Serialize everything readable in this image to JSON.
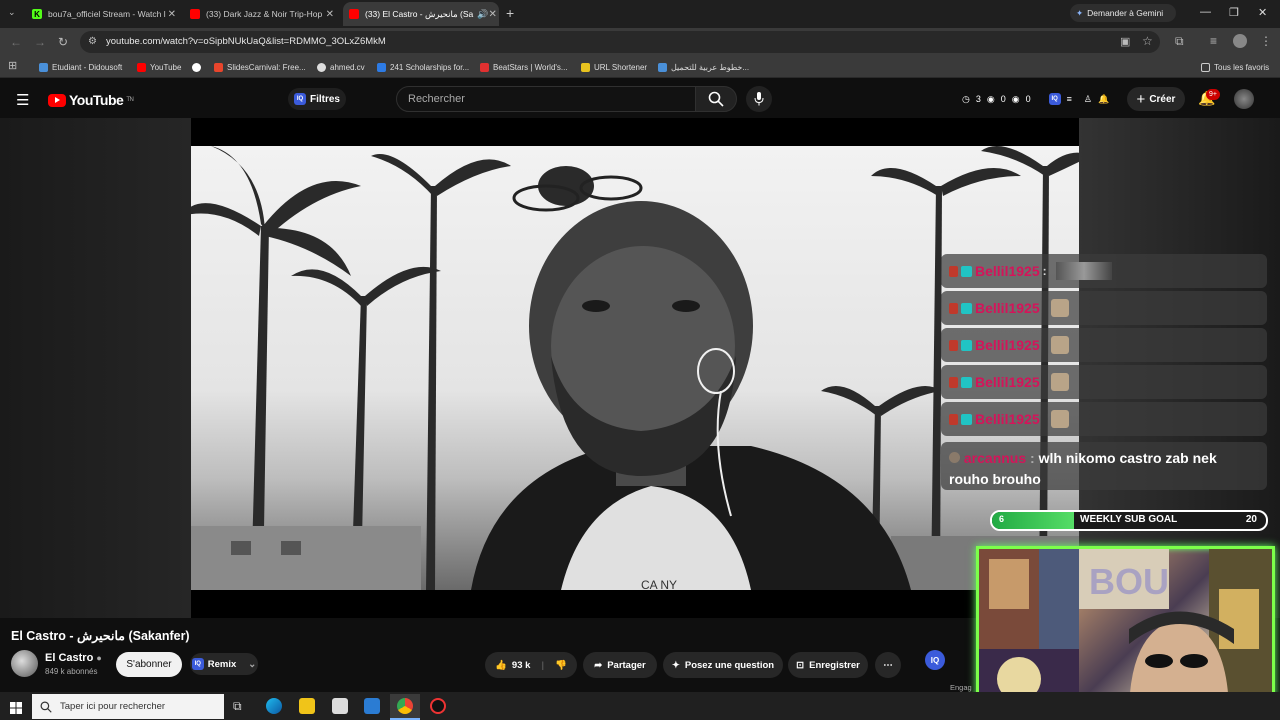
{
  "browser": {
    "tabs": [
      {
        "label": "bou7a_officiel Stream - Watch l",
        "favicon": "kick-icon",
        "active": false
      },
      {
        "label": "(33) Dark Jazz & Noir Trip-Hop",
        "favicon": "youtube-icon",
        "active": false
      },
      {
        "label": "(33) El Castro - مانحيرش (Sa",
        "favicon": "youtube-icon",
        "active": true
      }
    ],
    "new_tab": "+",
    "gemini_button": "Demander à Gemini",
    "url": "youtube.com/watch?v=oSipbNUkUaQ&list=RDMMO_3OLxZ6MkM",
    "bookmarks": [
      {
        "label": "Etudiant - Didousoft",
        "color": "#4a90d9"
      },
      {
        "label": "YouTube",
        "color": "#ff0000"
      },
      {
        "label": "",
        "color": "#ffffff"
      },
      {
        "label": "SlidesCarnival: Free...",
        "color": "#e8452c"
      },
      {
        "label": "ahmed.cv",
        "color": "#dddddd"
      },
      {
        "label": "241 Scholarships for...",
        "color": "#2d7be5"
      },
      {
        "label": "BeatStars | World's...",
        "color": "#e03030"
      },
      {
        "label": "URL Shortener",
        "color": "#e8c31f"
      },
      {
        "label": "خطوط عربية للتحميل...",
        "color": "#4a90d9"
      }
    ],
    "all_bookmarks": "Tous les favoris"
  },
  "youtube": {
    "logo_text": "YouTube",
    "logo_suffix": "TN",
    "filters_label": "Filtres",
    "search_placeholder": "Rechercher",
    "stats": [
      "3",
      "0",
      "0"
    ],
    "create_label": "Créer",
    "notif_badge": "9+"
  },
  "chat": {
    "messages": [
      {
        "user": "Bellil1925",
        "text": ":"
      },
      {
        "user": "Bellil1925",
        "text": ""
      },
      {
        "user": "Bellil1925",
        "text": ""
      },
      {
        "user": "Bellil1925",
        "text": ""
      },
      {
        "user": "Bellil1925",
        "text": ""
      }
    ],
    "last_user": "arcannus",
    "last_text": "wlh nikomo castro zab nek rouho brouho"
  },
  "goal": {
    "label": "WEEKLY SUB GOAL",
    "current": "6",
    "target": "20",
    "progress": 0.3
  },
  "video": {
    "title": "El Castro - مانحيرش (Sakanfer)",
    "channel": "El Castro",
    "subscribers": "849 k abonnés",
    "subscribe_label": "S'abonner",
    "remix_label": "Remix",
    "likes": "93 k",
    "share_label": "Partager",
    "ask_label": "Posez une question",
    "save_label": "Enregistrer",
    "engagement_label": "Engag"
  },
  "taskbar": {
    "search_placeholder": "Taper ici pour rechercher"
  }
}
